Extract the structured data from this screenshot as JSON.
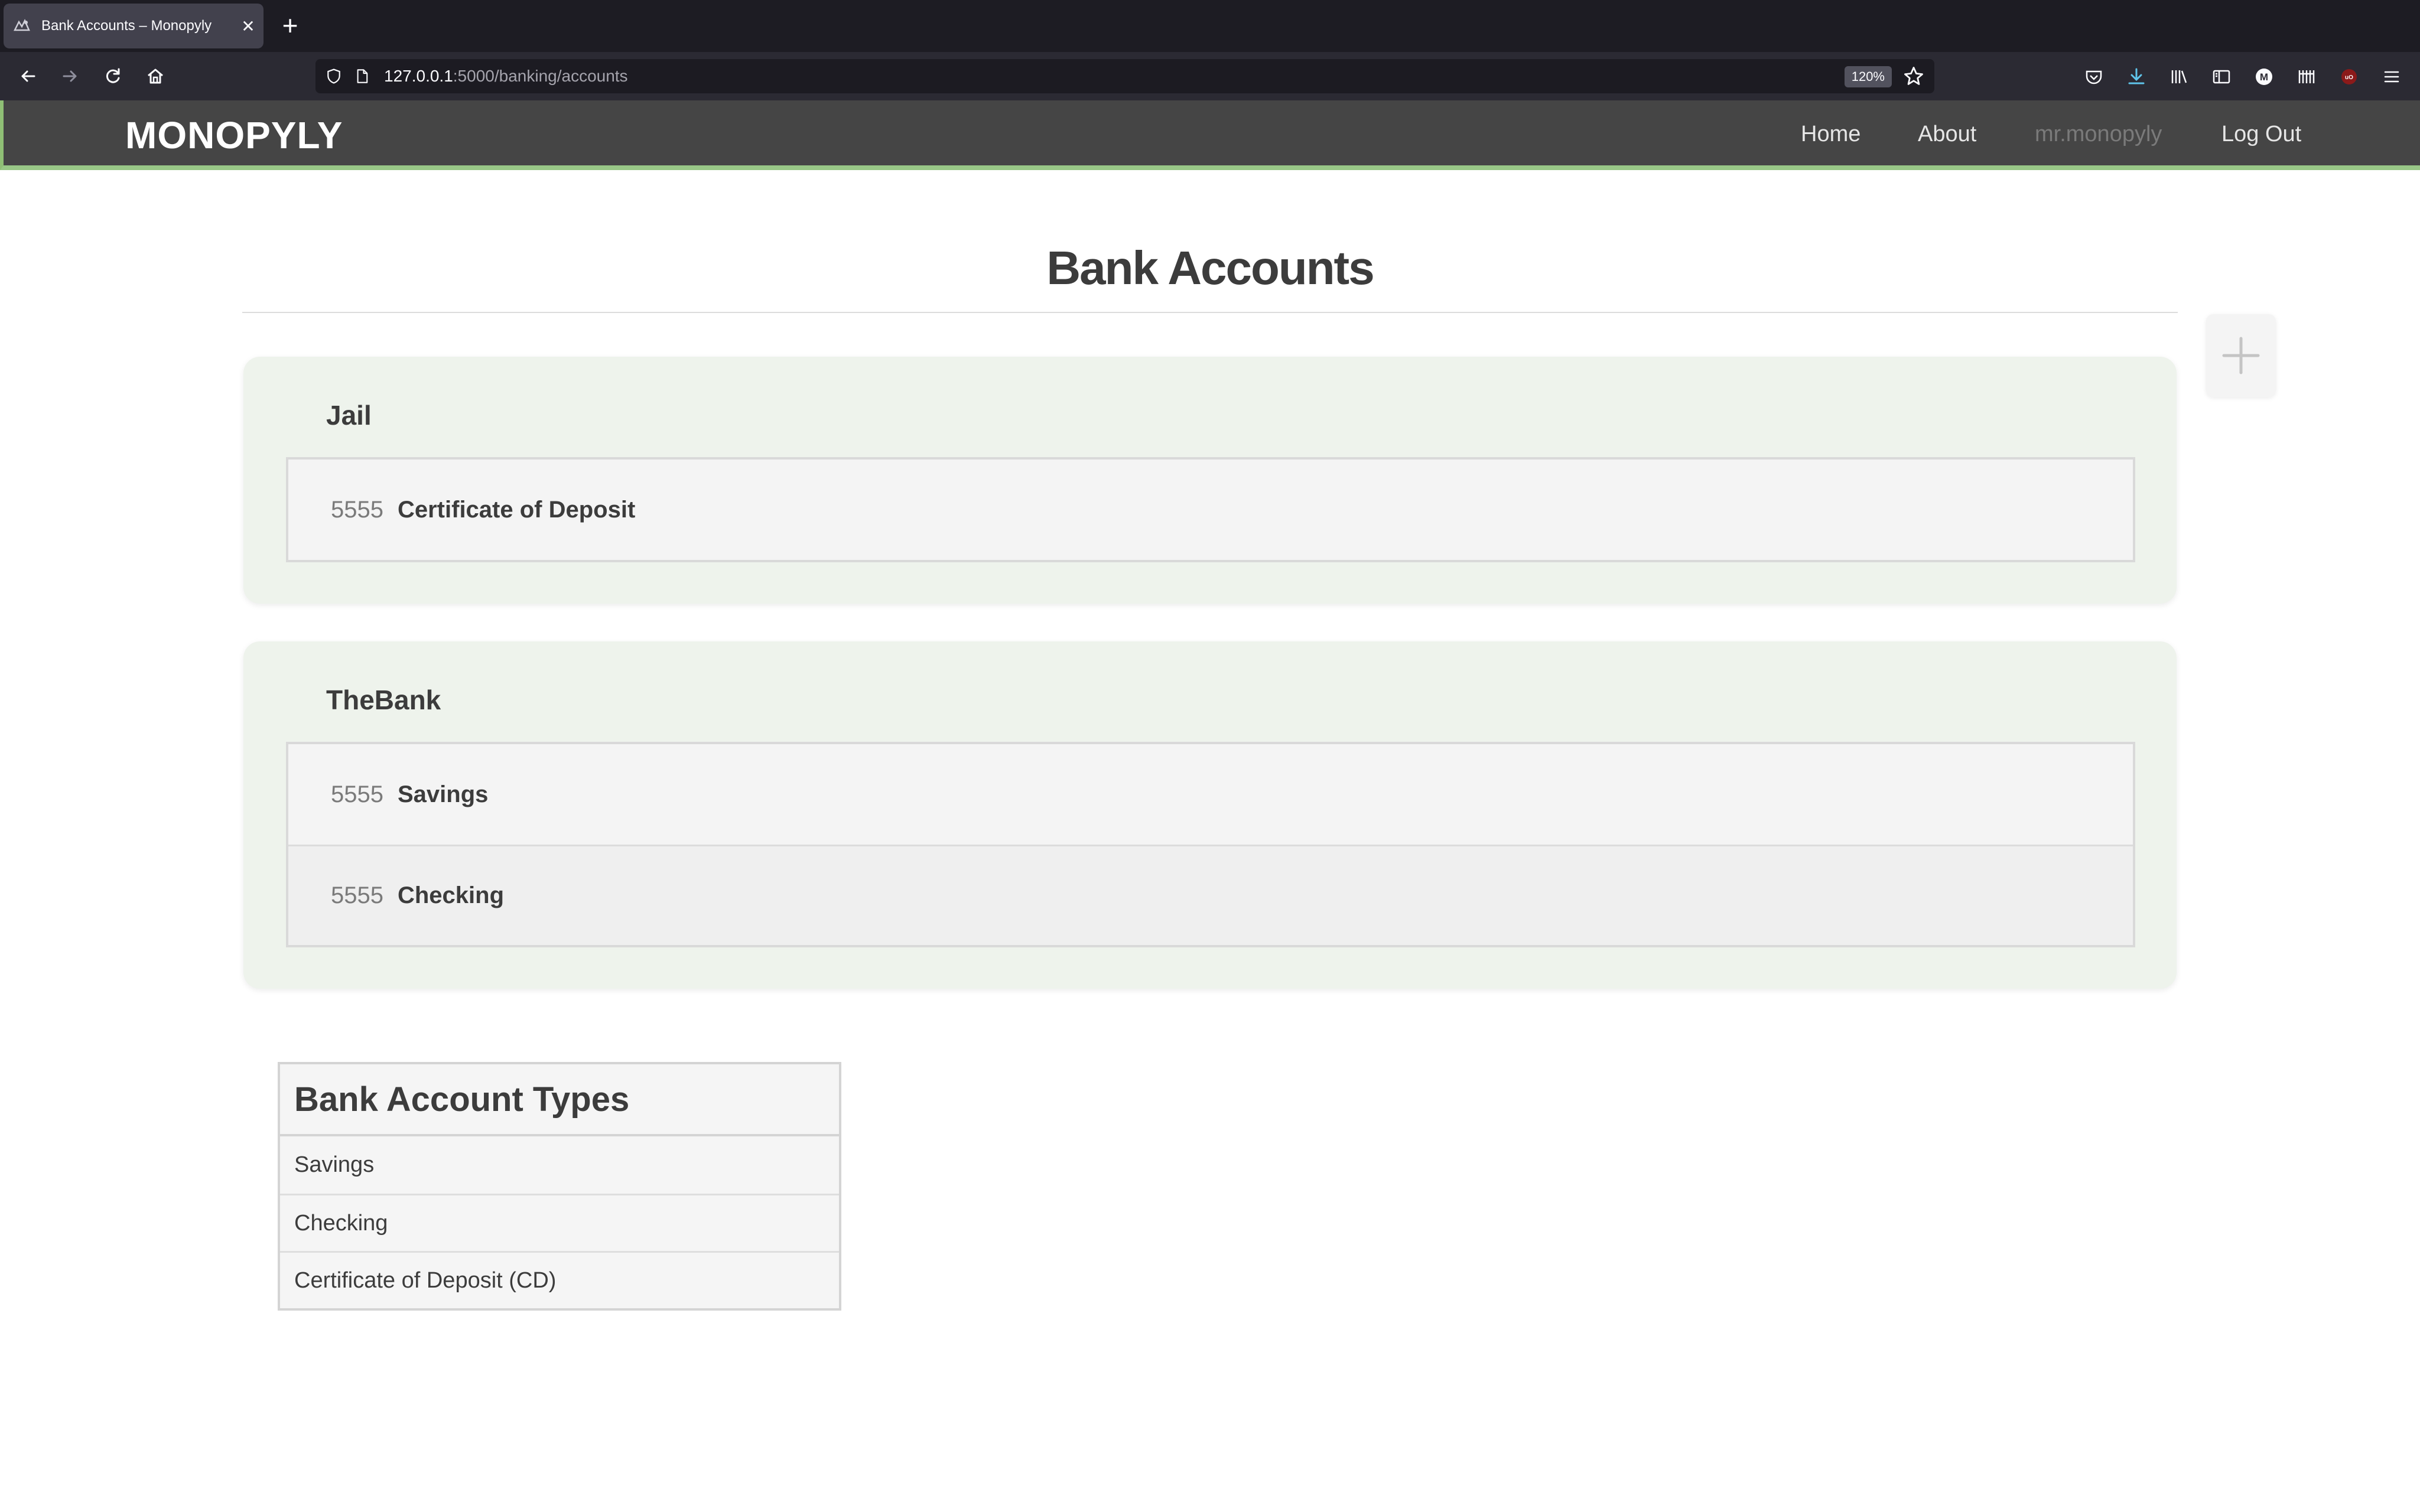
{
  "browser": {
    "tab_title": "Bank Accounts – Monopyly",
    "url_host": "127.0.0.1",
    "url_rest": ":5000/banking/accounts",
    "zoom": "120%"
  },
  "site": {
    "brand": "MONOPYLY",
    "nav": {
      "home": "Home",
      "about": "About",
      "user": "mr.monopyly",
      "logout": "Log Out"
    }
  },
  "page": {
    "title": "Bank Accounts"
  },
  "banks": [
    {
      "name": "Jail",
      "accounts": [
        {
          "number": "5555",
          "type": "Certificate of Deposit"
        }
      ]
    },
    {
      "name": "TheBank",
      "accounts": [
        {
          "number": "5555",
          "type": "Savings"
        },
        {
          "number": "5555",
          "type": "Checking"
        }
      ]
    }
  ],
  "account_types": {
    "header": "Bank Account Types",
    "items": [
      "Savings",
      "Checking",
      "Certificate of Deposit (CD)"
    ]
  },
  "colors": {
    "header_bg": "#454545",
    "accent_green": "#98c786",
    "card_bg": "#eef3ec"
  }
}
